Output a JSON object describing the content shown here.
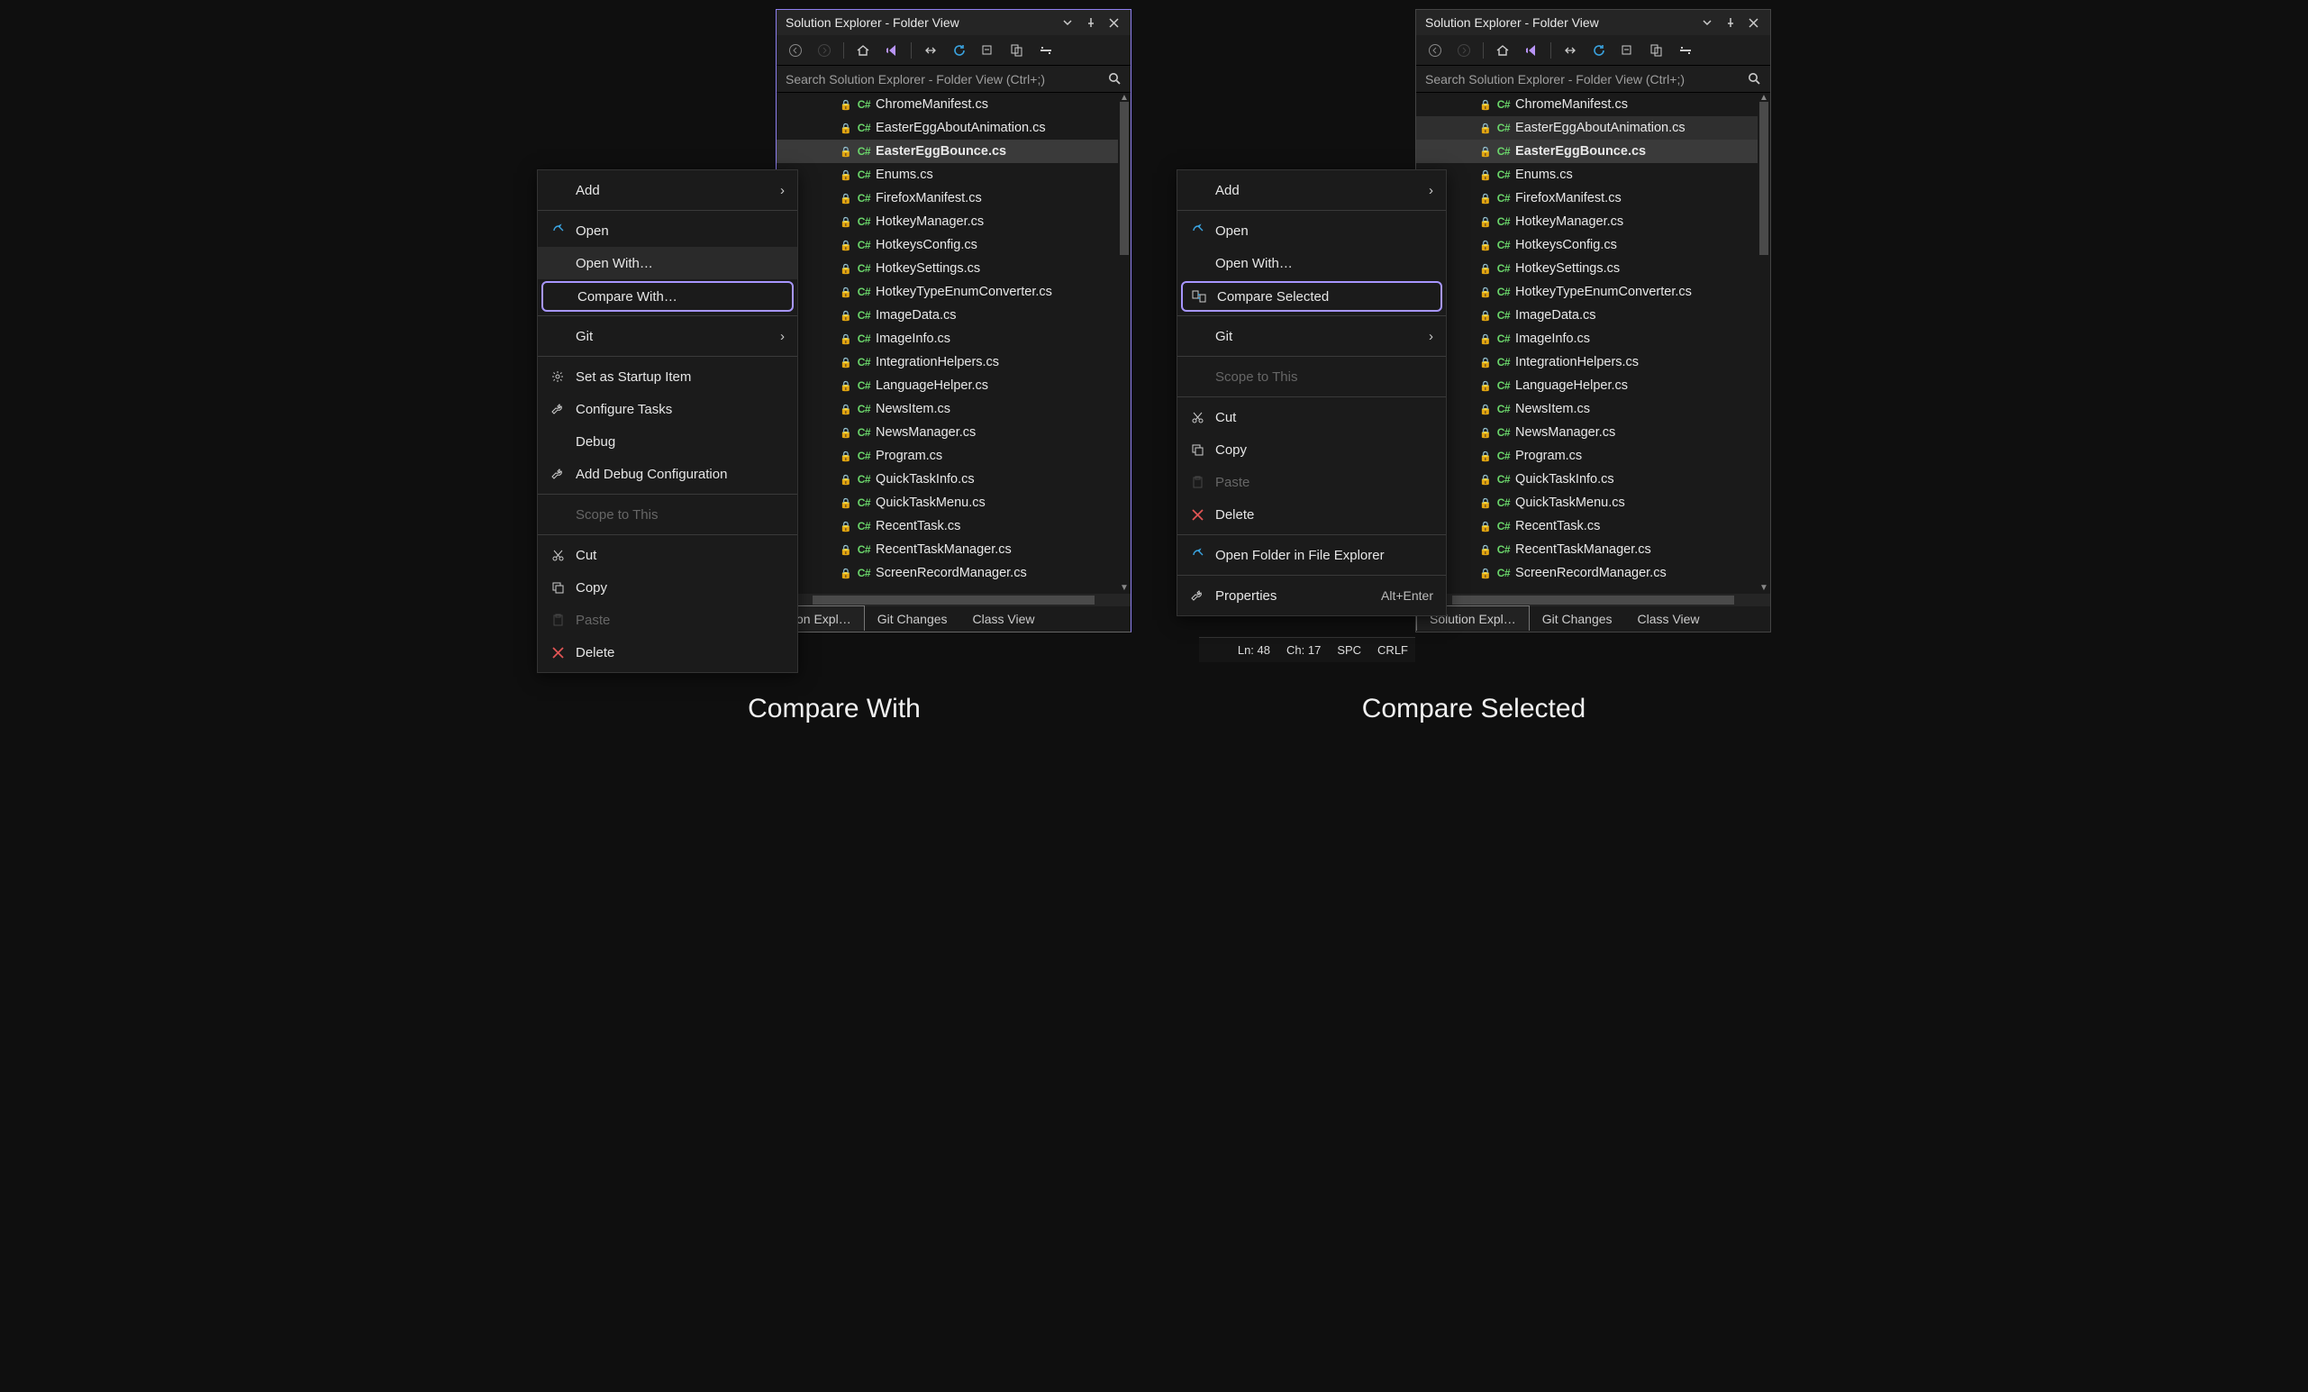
{
  "panel": {
    "title": "Solution Explorer - Folder View",
    "search_placeholder": "Search Solution Explorer - Folder View (Ctrl+;)"
  },
  "files": [
    "ChromeManifest.cs",
    "EasterEggAboutAnimation.cs",
    "EasterEggBounce.cs",
    "Enums.cs",
    "FirefoxManifest.cs",
    "HotkeyManager.cs",
    "HotkeysConfig.cs",
    "HotkeySettings.cs",
    "HotkeyTypeEnumConverter.cs",
    "ImageData.cs",
    "ImageInfo.cs",
    "IntegrationHelpers.cs",
    "LanguageHelper.cs",
    "NewsItem.cs",
    "NewsManager.cs",
    "Program.cs",
    "QuickTaskInfo.cs",
    "QuickTaskMenu.cs",
    "RecentTask.cs",
    "RecentTaskManager.cs",
    "ScreenRecordManager.cs"
  ],
  "file_selected_single": 2,
  "file_selected_multi": [
    1,
    2
  ],
  "tabs": {
    "a": {
      "active": "tion Expl…",
      "t2": "Git Changes",
      "t3": "Class View"
    },
    "b": {
      "active": "Solution Expl…",
      "t2": "Git Changes",
      "t3": "Class View"
    }
  },
  "statusbar": {
    "ln": "Ln: 48",
    "ch": "Ch: 17",
    "spc": "SPC",
    "crlf": "CRLF"
  },
  "menu_a": {
    "add": "Add",
    "open": "Open",
    "open_with": "Open With…",
    "compare_with": "Compare With…",
    "git": "Git",
    "set_startup": "Set as Startup Item",
    "configure_tasks": "Configure Tasks",
    "debug": "Debug",
    "add_debug_cfg": "Add Debug Configuration",
    "scope": "Scope to This",
    "cut": "Cut",
    "copy": "Copy",
    "paste": "Paste",
    "delete": "Delete"
  },
  "menu_b": {
    "add": "Add",
    "open": "Open",
    "open_with": "Open With…",
    "compare_selected": "Compare Selected",
    "git": "Git",
    "scope": "Scope to This",
    "cut": "Cut",
    "copy": "Copy",
    "paste": "Paste",
    "delete": "Delete",
    "open_folder": "Open Folder in File Explorer",
    "properties": "Properties",
    "properties_short": "Alt+Enter"
  },
  "captions": {
    "a": "Compare With",
    "b": "Compare Selected"
  }
}
